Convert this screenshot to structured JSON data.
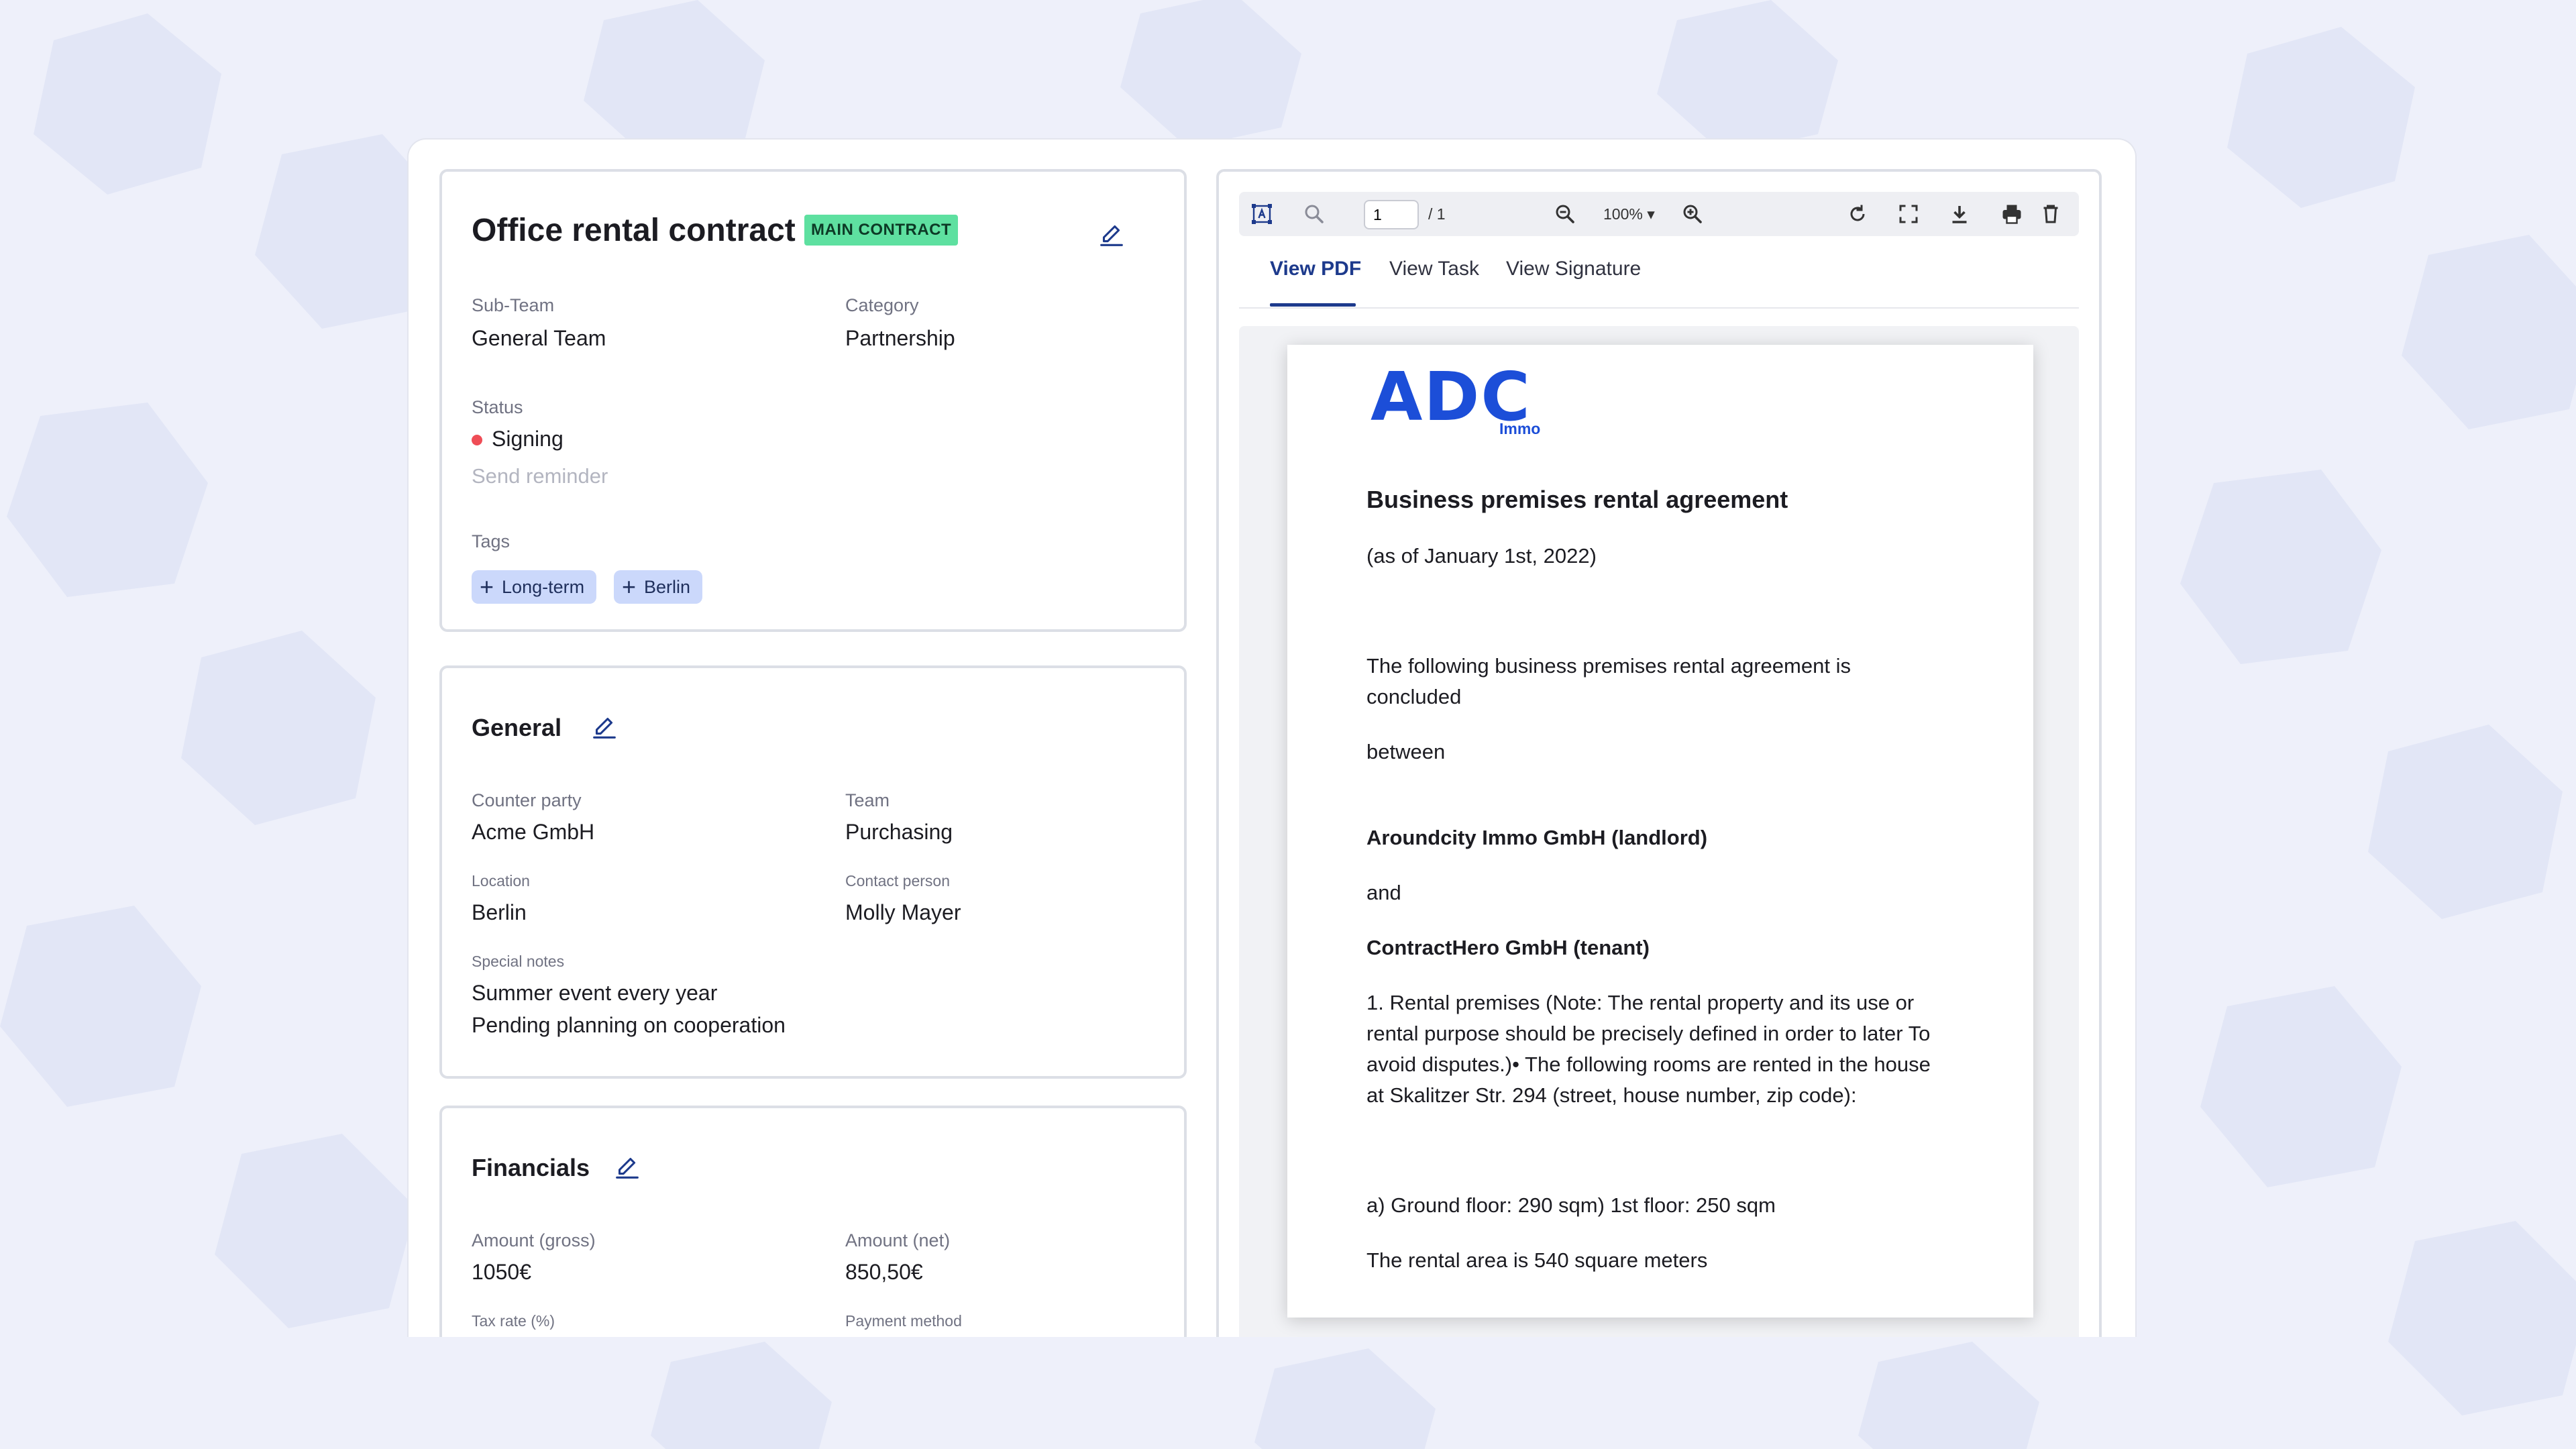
{
  "contract": {
    "title": "Office rental contract",
    "badge": "MAIN CONTRACT",
    "subteam_label": "Sub-Team",
    "subteam_value": "General Team",
    "category_label": "Category",
    "category_value": "Partnership",
    "status_label": "Status",
    "status_value": "Signing",
    "status_color": "#ef4d56",
    "send_reminder": "Send reminder",
    "tags_label": "Tags",
    "tags": [
      "Long-term",
      "Berlin"
    ]
  },
  "general": {
    "title": "General",
    "counterparty_label": "Counter party",
    "counterparty_value": "Acme GmbH",
    "team_label": "Team",
    "team_value": "Purchasing",
    "location_label": "Location",
    "location_value": "Berlin",
    "contact_label": "Contact person",
    "contact_value": "Molly Mayer",
    "notes_label": "Special notes",
    "notes_line1": "Summer event every year",
    "notes_line2": "Pending planning on cooperation"
  },
  "financials": {
    "title": "Financials",
    "gross_label": "Amount (gross)",
    "gross_value": "1050€",
    "net_label": "Amount (net)",
    "net_value": "850,50€",
    "tax_label": "Tax rate (%)",
    "payment_label": "Payment method"
  },
  "viewer": {
    "page_current": "1",
    "page_total": "/ 1",
    "zoom": "100% ▾",
    "tabs": [
      "View PDF",
      "View Task",
      "View Signature"
    ],
    "active_tab": "View PDF"
  },
  "pdf": {
    "logo_main": "ADC",
    "logo_sub": "Immo",
    "heading": "Business premises rental agreement",
    "date": "(as of January 1st, 2022)",
    "intro_line1": "The following business premises rental agreement is",
    "intro_line2": "concluded",
    "between": "between",
    "landlord": "Aroundcity Immo GmbH (landlord)",
    "and": "and",
    "tenant": "ContractHero GmbH (tenant)",
    "clause1_line1": "1. Rental premises (Note: The rental property and its use or",
    "clause1_line2": "rental purpose should be precisely defined in order to later To",
    "clause1_line3": "avoid disputes.)• The following rooms are rented in the house",
    "clause1_line4": "at Skalitzer Str. 294 (street, house number, zip code):",
    "floors": "a) Ground floor: 290 sqm) 1st floor: 250 sqm",
    "area": "The rental area is 540 square meters"
  },
  "colors": {
    "accent": "#1d3a8c",
    "badge_bg": "#5ee0a0",
    "tag_bg": "#cbd8fb",
    "logo": "#1c4ed8",
    "page_bg": "#eef0fa"
  }
}
